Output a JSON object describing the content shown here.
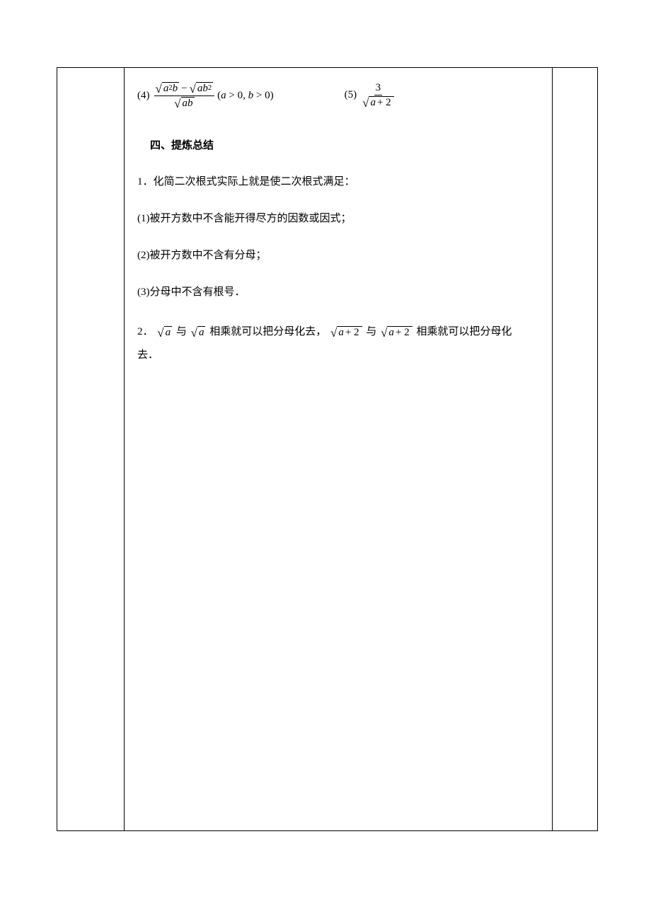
{
  "problems": {
    "p4": {
      "label": "(4)",
      "num_sqrt1": "a",
      "num_sqrt1_sup": "2",
      "num_sqrt1_tail": "b",
      "num_sqrt2_a": "ab",
      "num_sqrt2_sup": "2",
      "den_sqrt": "ab",
      "condition": "(a > 0, b > 0)",
      "minus": "−"
    },
    "p5": {
      "label": "(5)",
      "num": "3",
      "den_var": "a",
      "den_plus": "+ 2"
    }
  },
  "section_heading": "四、提炼总结",
  "summary1_intro": "1．化简二次根式实际上就是使二次根式满足：",
  "summary1_item1": "(1)被开方数中不含能开得尽方的因数或因式；",
  "summary1_item2": "(2)被开方数中不含有分母；",
  "summary1_item3": "(3)分母中不含有根号．",
  "summary2": {
    "prefix": "2．",
    "sqrt_a": "a",
    "mid1": " 与",
    "mid2": " 相乘就可以把分母化去，",
    "sqrt_a2_var": "a",
    "sqrt_a2_plus": "+ 2",
    "mid3": " 与",
    "mid4": " 相乘就可以把分母化",
    "tail": "去．"
  }
}
